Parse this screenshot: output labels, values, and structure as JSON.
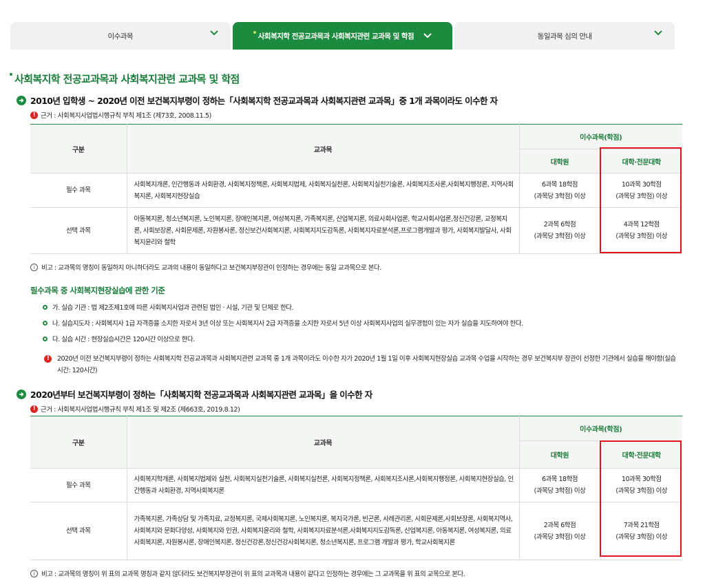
{
  "tabs": [
    {
      "label": "이수과목",
      "active": false
    },
    {
      "label": "사회복지학 전공교과목과 사회복지관련 교과목 및 학점",
      "active": true
    },
    {
      "label": "동일과목 심의 안내",
      "active": false
    }
  ],
  "page_title": "사회복지학 전공교과목과 사회복지관련 교과목 및 학점",
  "section1": {
    "heading": "2010년 입학생 ~ 2020년 이전 보건복지부령이 정하는「사회복지학 전공교과목과 사회복지관련 교과목」중 1개 과목이라도 이수한 자",
    "basis": "근거 : 사회복지사업법시행규칙 부칙 제1조 (제73호, 2008.11.5)",
    "table": {
      "col_category": "구분",
      "col_subjects": "교과목",
      "col_credits": "이수과목(학점)",
      "col_grad": "대학원",
      "col_univ": "대학·전문대학",
      "rows": [
        {
          "category": "필수 과목",
          "subjects": "사회복지개론, 인간행동과 사회환경, 사회복지정책론, 사회복지법제, 사회복지실천론, 사회복지실천기술론, 사회복지조사론,사회복지행정론, 지역사회복지론, 사회복지현장실습",
          "grad_line1": "6과목 18학점",
          "grad_line2": "(과목당 3학점) 이상",
          "univ_line1": "10과목 30학점",
          "univ_line2": "(과목당 3학점) 이상"
        },
        {
          "category": "선택 과목",
          "subjects": "아동복지론, 청소년복지론, 노인복지론, 장애인복지론, 여성복지론, 가족복지론, 산업복지론, 의료사회사업론, 학교사회사업론,정신건강론, 교정복지론, 사회보장론, 사회문제론, 자원봉사론, 정신보건사회복지론, 사회복지지도감독론, 사회복지자료분석론,프로그램개발과 평가, 사회복지발달사, 사회복지윤리와 철학",
          "grad_line1": "2과목 6학점",
          "grad_line2": "(과목당 3학점) 이상",
          "univ_line1": "4과목 12학점",
          "univ_line2": "(과목당 3학점) 이상"
        }
      ]
    },
    "note": "비고 : 교과목의 명칭이 동일하지 아니하더라도 교과의 내용이 동일하다고 보건복지부장관이 인정하는 경우에는 동일 교과목으로 본다."
  },
  "practice": {
    "title": "필수과목 중 사회복지현장실습에 관한 기준",
    "items": [
      "가. 실습 기관 : 법 제2조제1호에 따른 사회복지사업과 관련된 법인 · 시설, 기관 및 단체로 한다.",
      "나. 실습지도자 : 사회복지사 1급 자격증을 소지한 자로서 3년 이상 또는 사회복지사 2급 자격증을 소지한 자로서 5년 이상 사회복지사업의 실무경험이 있는 자가 실습을 지도하여야 한다.",
      "다. 실습 시간 : 현장실습시간은 120시간 이상으로 한다."
    ],
    "warning": "2020년 이전 보건복지부령이 정하는 사회복지학 전공교과목과 사회복지관련 교과목 중 1개 과목이라도 이수한 자가 2020년 1월 1일 이후 사회복지현장실습 교과목 수업을 시작하는 경우 보건복지부 장관이 선정한 기관에서 실습을 해야함(실습시간: 120시간)"
  },
  "section2": {
    "heading": "2020년부터 보건복지부령이 정하는「사회복지학 전공교과목과 사회복지관련 교과목」을 이수한 자",
    "basis": "근거 : 사회복지사업법시행규칙 부칙 제1조 및 제2조 (제663호, 2019.8.12)",
    "table": {
      "col_category": "구분",
      "col_subjects": "교과목",
      "col_credits": "이수과목(학점)",
      "col_grad": "대학원",
      "col_univ": "대학·전문대학",
      "rows": [
        {
          "category": "필수 과목",
          "subjects": "사회복지학개론, 사회복지법제와 실천, 사회복지실천기술론, 사회복지실천론, 사회복지정책론, 사회복지조사론,사회복지행정론, 사회복지현장실습, 인간행동과 사회환경, 지역사회복지론",
          "grad_line1": "6과목 18학점",
          "grad_line2": "(과목당 3학점) 이상",
          "univ_line1": "10과목 30학점",
          "univ_line2": "(과목당 3학점) 이상"
        },
        {
          "category": "선택 과목",
          "subjects": "가족복지론, 가족상담 및 가족치료, 교정복지론, 국제사회복지론, 노인복지론, 복지국가론, 빈곤론, 사례관리론, 사회문제론,사회보장론, 사회복지역사, 사회복지와 문화다양성, 사회복지와 인권, 사회복지윤리와 철학, 사회복지자료분석론,사회복지지도감독론, 산업복지론, 아동복지론, 여성복지론, 의료사회복지론, 자원봉사론, 장애인복지론, 정신건강론,정신건강사회복지론, 청소년복지론, 프로그램 개발과 평가, 학교사회복지론",
          "grad_line1": "2과목 6학점",
          "grad_line2": "(과목당 3학점) 이상",
          "univ_line1": "7과목 21학점",
          "univ_line2": "(과목당 3학점) 이상"
        }
      ]
    },
    "note": "비고 : 교과목의 명칭이 위 표의 교과목 명칭과 같지 않더라도 보건복지부장관이 위 표의 교과목과 내용이 같다고 인정하는 경우에는 그 교과목을 위 표의 교목으로 본다."
  },
  "colors": {
    "brand_green": "#1c8a3f",
    "title_green": "#1a7d3b",
    "warning_red": "#d8261f",
    "highlight_red": "#e0121b"
  }
}
